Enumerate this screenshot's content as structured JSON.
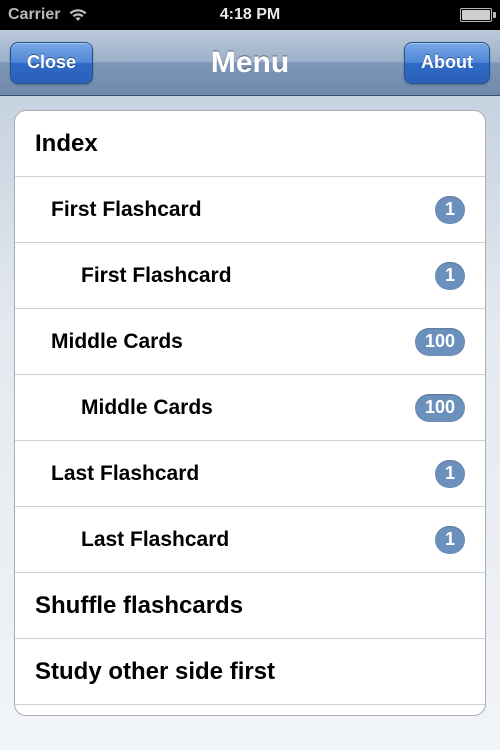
{
  "status": {
    "carrier": "Carrier",
    "time": "4:18 PM"
  },
  "nav": {
    "title": "Menu",
    "close_label": "Close",
    "about_label": "About"
  },
  "index": {
    "header": "Index",
    "items": [
      {
        "label": "First Flashcard",
        "count": "1",
        "level": 0
      },
      {
        "label": "First Flashcard",
        "count": "1",
        "level": 1
      },
      {
        "label": "Middle Cards",
        "count": "100",
        "level": 0
      },
      {
        "label": "Middle Cards",
        "count": "100",
        "level": 1
      },
      {
        "label": "Last Flashcard",
        "count": "1",
        "level": 0
      },
      {
        "label": "Last Flashcard",
        "count": "1",
        "level": 1
      }
    ]
  },
  "options": {
    "shuffle": "Shuffle flashcards",
    "study_other": "Study other side first"
  },
  "colors": {
    "badge_bg": "#6b90bb",
    "nav_btn_bg": "#2f6ac7"
  }
}
